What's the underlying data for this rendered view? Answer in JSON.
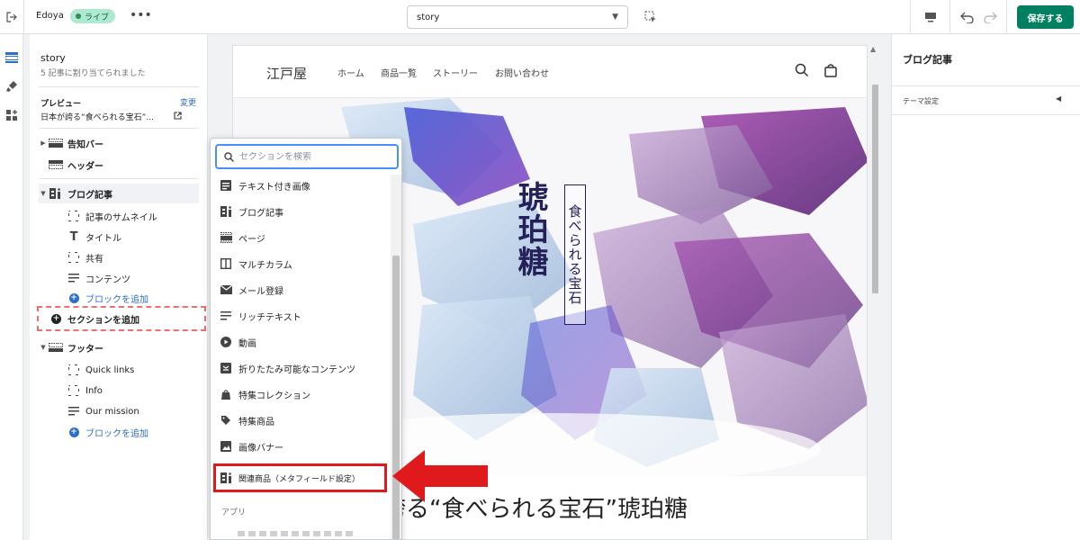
{
  "topbar": {
    "store_name": "Edoya",
    "status_badge": "ライブ",
    "template_value": "story",
    "save_label": "保存する"
  },
  "sidebar": {
    "title": "story",
    "subtitle": "5 記事に割り当てられました",
    "preview_label": "プレビュー",
    "change_link": "変更",
    "preview_value": "日本が誇る“食べられる宝石”...",
    "tree": [
      {
        "label": "告知バー",
        "level": 0,
        "expandable": true
      },
      {
        "label": "ヘッダー",
        "level": 0,
        "expandable": false
      },
      {
        "label": "ブログ記事",
        "level": 0,
        "expandable": true,
        "selected": true
      },
      {
        "label": "記事のサムネイル",
        "level": 1
      },
      {
        "label": "タイトル",
        "level": 1
      },
      {
        "label": "共有",
        "level": 1
      },
      {
        "label": "コンテンツ",
        "level": 1
      },
      {
        "label": "ブロックを追加",
        "level": 1,
        "link": true
      },
      {
        "label": "フッター",
        "level": 0,
        "expandable": true
      },
      {
        "label": "Quick links",
        "level": 1
      },
      {
        "label": "Info",
        "level": 1
      },
      {
        "label": "Our mission",
        "level": 1
      },
      {
        "label": "ブロックを追加",
        "level": 1,
        "link": true
      }
    ],
    "add_section_label": "セクションを追加"
  },
  "popover": {
    "search_placeholder": "セクションを検索",
    "items": [
      {
        "label": "テキスト付き画像",
        "icon": "text-image-icon"
      },
      {
        "label": "ブログ記事",
        "icon": "blog-icon"
      },
      {
        "label": "ページ",
        "icon": "page-icon"
      },
      {
        "label": "マルチカラム",
        "icon": "columns-icon"
      },
      {
        "label": "メール登録",
        "icon": "mail-icon"
      },
      {
        "label": "リッチテキスト",
        "icon": "rich-text-icon"
      },
      {
        "label": "動画",
        "icon": "play-icon"
      },
      {
        "label": "折りたたみ可能なコンテンツ",
        "icon": "collapsible-icon"
      },
      {
        "label": "特集コレクション",
        "icon": "collection-icon"
      },
      {
        "label": "特集商品",
        "icon": "tag-icon"
      },
      {
        "label": "画像バナー",
        "icon": "image-icon"
      },
      {
        "label": "関連商品（メタフィールド設定）",
        "icon": "blog-icon",
        "highlighted": true
      }
    ],
    "group_apps": "アプリ"
  },
  "preview": {
    "logo": "江戸屋",
    "nav": [
      "ホーム",
      "商品一覧",
      "ストーリー",
      "お問い合わせ"
    ],
    "hero_title": "琥珀糖",
    "hero_subtitle": "食べられる宝石",
    "heading": "誇る“食べられる宝石”琥珀糖"
  },
  "right_panel": {
    "title": "ブログ記事",
    "theme_settings": "テーマ設定"
  },
  "colors": {
    "save_green": "#008060",
    "live_badge": "#aee9d1",
    "link_blue": "#2c6ecb",
    "highlight_red": "#e0191d",
    "hero_ink": "#23205a"
  }
}
